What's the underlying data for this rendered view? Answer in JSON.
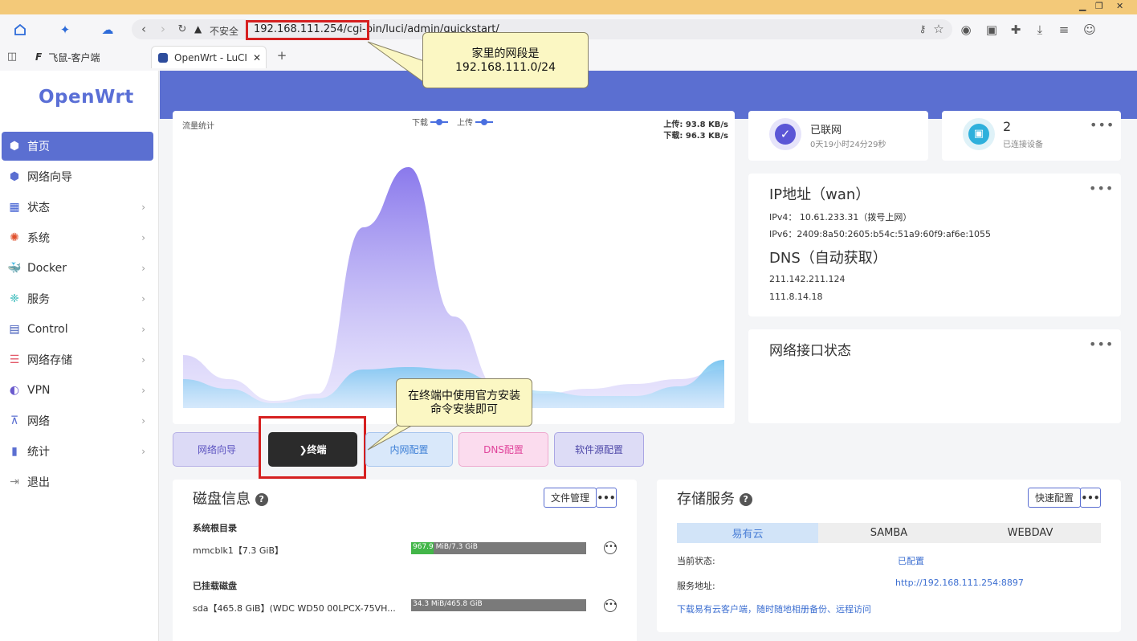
{
  "window": {
    "minimize": "▁",
    "restore": "❐",
    "close": "✕"
  },
  "browser": {
    "unsafe_label": "不安全",
    "url": "192.168.111.254/cgi-bin/luci/admin/quickstart/",
    "tabs": [
      {
        "label": "飞鼠-客户端"
      },
      {
        "label": "OpenWrt - LuCI",
        "active": true
      }
    ]
  },
  "sidebar": {
    "logo": "OpenWrt",
    "items": [
      {
        "label": "首页",
        "icon": "cube-icon",
        "active": true
      },
      {
        "label": "网络向导",
        "icon": "cube-icon"
      },
      {
        "label": "状态",
        "icon": "dashboard-icon"
      },
      {
        "label": "系统",
        "icon": "gear-icon"
      },
      {
        "label": "Docker",
        "icon": "docker-icon"
      },
      {
        "label": "服务",
        "icon": "services-icon"
      },
      {
        "label": "Control",
        "icon": "control-icon"
      },
      {
        "label": "网络存储",
        "icon": "storage-icon"
      },
      {
        "label": "VPN",
        "icon": "vpn-icon"
      },
      {
        "label": "网络",
        "icon": "network-icon"
      },
      {
        "label": "统计",
        "icon": "stats-icon"
      },
      {
        "label": "退出",
        "icon": "logout-icon"
      }
    ]
  },
  "traffic": {
    "title": "流量统计",
    "legend_download": "下载",
    "legend_upload": "上传",
    "upload_rate": "上传: 93.8 KB/s",
    "download_rate": "下载: 96.3 KB/s"
  },
  "chart_data": {
    "type": "area",
    "title": "流量统计",
    "series": [
      {
        "name": "下载",
        "values": [
          0.22,
          0.12,
          0.03,
          0.06,
          0.75,
          1.0,
          0.38,
          0.08,
          0.06,
          0.08,
          0.1,
          0.12,
          0.16
        ]
      },
      {
        "name": "上传",
        "values": [
          0.12,
          0.08,
          0.02,
          0.04,
          0.16,
          0.17,
          0.16,
          0.11,
          0.07,
          0.05,
          0.05,
          0.09,
          0.2
        ]
      }
    ],
    "grid": false,
    "legend": "top-center"
  },
  "quick_buttons": [
    "网络向导",
    "❯终端",
    "内网配置",
    "DNS配置",
    "软件源配置"
  ],
  "callouts": {
    "subnet": "家里的网段是\n192.168.111.0/24",
    "terminal": "在终端中使用官方安装\n命令安装即可"
  },
  "status": {
    "connected_title": "已联网",
    "uptime": "0天19小时24分29秒",
    "devices_count": "2",
    "devices_label": "已连接设备"
  },
  "ip": {
    "title": "IP地址（wan）",
    "ipv4": "IPv4： 10.61.233.31（拨号上网）",
    "ipv6": "IPv6：2409:8a50:2605:b54c:51a9:60f9:af6e:1055",
    "dns_title": "DNS（自动获取）",
    "dns1": "211.142.211.124",
    "dns2": "111.8.14.18"
  },
  "iface": {
    "title": "网络接口状态"
  },
  "disk": {
    "title": "磁盘信息",
    "file_manager": "文件管理",
    "root_section": "系统根目录",
    "root_name": "mmcblk1【7.3 GiB】",
    "root_usage": "967.9 MiB/7.3 GiB",
    "root_fraction": 0.13,
    "mounted_section": "已挂载磁盘",
    "sda_name": "sda【465.8 GiB】(WDC WD50 00LPCX-75VH...",
    "sda_usage": "34.3 MiB/465.8 GiB",
    "sda_fraction": 0.0001
  },
  "storage": {
    "title": "存储服务",
    "quick_config": "快速配置",
    "tabs": [
      "易有云",
      "SAMBA",
      "WEBDAV"
    ],
    "state_label": "当前状态:",
    "state_value": "已配置",
    "addr_label": "服务地址:",
    "addr_value": "http://192.168.111.254:8897",
    "download_link": "下载易有云客户端，随时随地相册备份、远程访问"
  },
  "colors": {
    "accent": "#5b6fd1",
    "title_bar": "#f3c979",
    "highlight": "#d62020"
  }
}
